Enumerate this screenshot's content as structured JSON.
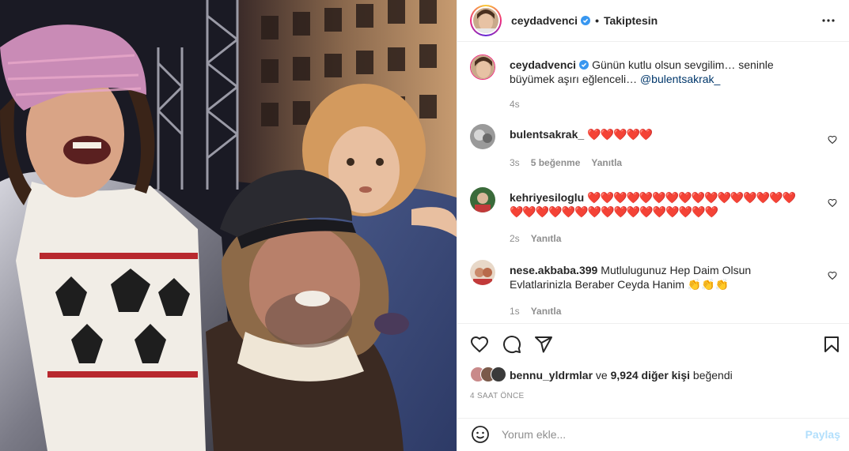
{
  "post": {
    "author": "ceydadvenci",
    "separator": "•",
    "follow_state": "Takiptesin"
  },
  "caption": {
    "user": "ceydadvenci",
    "text": "Günün kutlu olsun sevgilim… seninle büyümek aşırı eğlenceli… ",
    "mention": "@bulentsakrak_",
    "time": "4s"
  },
  "comments": [
    {
      "user": "bulentsakrak_",
      "text": "❤️❤️❤️❤️❤️",
      "time": "3s",
      "likes": "5 beğenme",
      "reply": "Yanıtla"
    },
    {
      "user": "kehriyesiloglu",
      "text": "❤️❤️❤️❤️❤️❤️❤️❤️❤️❤️❤️❤️❤️❤️❤️❤️❤️❤️❤️❤️❤️❤️❤️❤️❤️❤️❤️❤️❤️❤️❤️❤️",
      "time": "2s",
      "reply": "Yanıtla"
    },
    {
      "user": "nese.akbaba.399",
      "text": "Mutlulugunuz Hep Daim Olsun Evlatlarinizla Beraber Ceyda Hanim 👏👏👏",
      "time": "1s",
      "reply": "Yanıtla"
    }
  ],
  "likes_summary": {
    "user": "bennu_yldrmlar",
    "connector": " ve ",
    "others": "9,924 diğer kişi",
    "suffix": " beğendi"
  },
  "timestamp": "4 saat önce",
  "comment_box": {
    "placeholder": "Yorum ekle...",
    "share_label": "Paylaş"
  },
  "icons": {
    "verified": "verified-badge-icon",
    "more": "more-options-icon",
    "like": "heart-icon",
    "comment": "comment-icon",
    "share": "paper-plane-icon",
    "save": "bookmark-icon",
    "emoji": "emoji-icon"
  },
  "colors": {
    "verified_blue": "#3897f0",
    "link": "#00376b",
    "muted": "#8e8e8e",
    "share_disabled": "#b2dffc",
    "heart_red": "#e0245e"
  }
}
